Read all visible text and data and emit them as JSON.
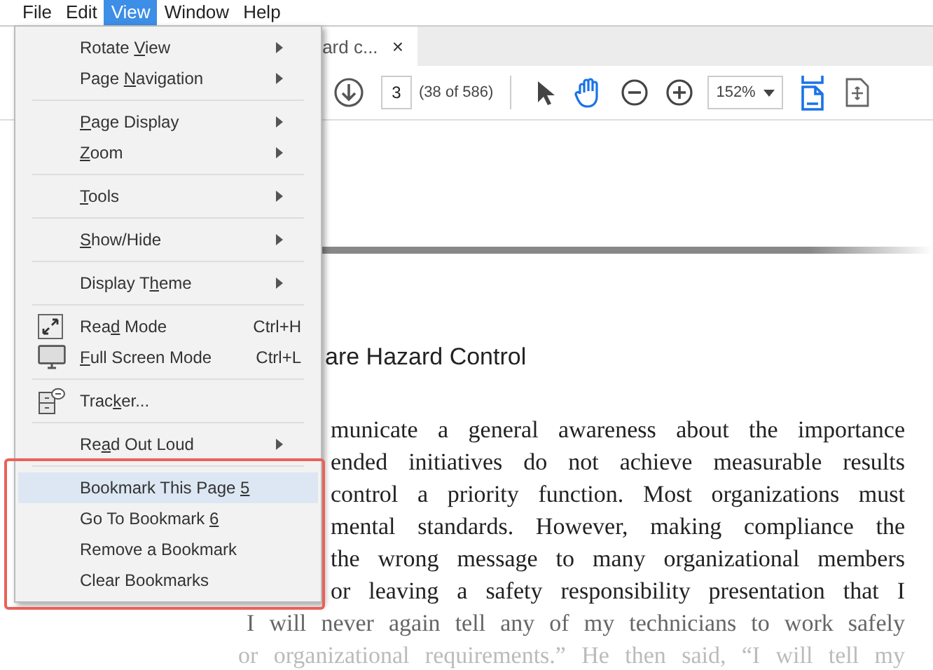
{
  "menubar": [
    {
      "label": "File",
      "selected": false
    },
    {
      "label": "Edit",
      "selected": false
    },
    {
      "label": "View",
      "selected": true
    },
    {
      "label": "Window",
      "selected": false
    },
    {
      "label": "Help",
      "selected": false
    }
  ],
  "document_tab": {
    "title": "ard c...",
    "close": "×"
  },
  "toolbar": {
    "page_number": "3",
    "page_count": "(38 of 586)",
    "zoom": "152%"
  },
  "view_menu": {
    "items": [
      {
        "kind": "submenu",
        "label": {
          "before": "Rotate ",
          "key": "V",
          "after": "iew"
        },
        "selected": false
      },
      {
        "kind": "submenu",
        "label": {
          "before": "Page ",
          "key": "N",
          "after": "avigation"
        },
        "selected": false
      },
      {
        "kind": "separator"
      },
      {
        "kind": "submenu",
        "label": {
          "key": "P",
          "after": "age Display"
        },
        "selected": false
      },
      {
        "kind": "submenu",
        "label": {
          "key": "Z",
          "after": "oom"
        },
        "selected": false
      },
      {
        "kind": "separator"
      },
      {
        "kind": "submenu",
        "label": {
          "key": "T",
          "after": "ools"
        },
        "selected": false
      },
      {
        "kind": "separator"
      },
      {
        "kind": "submenu",
        "label": {
          "key": "S",
          "after": "how/Hide"
        },
        "selected": false
      },
      {
        "kind": "separator"
      },
      {
        "kind": "submenu",
        "label": {
          "before": "Display T",
          "key": "h",
          "after": "eme"
        },
        "selected": false
      },
      {
        "kind": "separator"
      },
      {
        "kind": "command",
        "icon": true,
        "label": {
          "before": "Rea",
          "key": "d",
          "after": " Mode"
        },
        "shortcut": "Ctrl+H",
        "selected": false
      },
      {
        "kind": "command",
        "icon": true,
        "label": {
          "key": "F",
          "after": "ull Screen Mode"
        },
        "shortcut": "Ctrl+L",
        "selected": false
      },
      {
        "kind": "separator"
      },
      {
        "kind": "command",
        "icon": true,
        "label": {
          "before": "Trac",
          "key": "k",
          "after": "er..."
        },
        "selected": false
      },
      {
        "kind": "separator"
      },
      {
        "kind": "submenu",
        "label": {
          "before": "Re",
          "key": "a",
          "after": "d Out Loud"
        },
        "selected": false
      },
      {
        "kind": "separator"
      },
      {
        "kind": "command",
        "label": {
          "before": "Bookmark This Page ",
          "key": "5"
        },
        "selected": true
      },
      {
        "kind": "command",
        "label": {
          "before": "Go To Bookmark ",
          "key": "6"
        },
        "selected": false
      },
      {
        "kind": "command",
        "label": {
          "before": "Remove a Bookmark"
        },
        "selected": false
      },
      {
        "kind": "command",
        "label": {
          "before": "Clear Bookmarks"
        },
        "selected": false
      }
    ]
  },
  "document": {
    "heading": "are Hazard Control",
    "lines": [
      "municate a general awareness about the importance",
      "ended initiatives do not achieve measurable results",
      "control a priority function. Most organizations must",
      "mental standards. However, making compliance the",
      "the wrong message to many organizational members",
      "or leaving a safety responsibility presentation that I",
      "I will never again tell any of my technicians to work safely",
      "or organizational requirements.” He then said, “I will tell my"
    ]
  }
}
